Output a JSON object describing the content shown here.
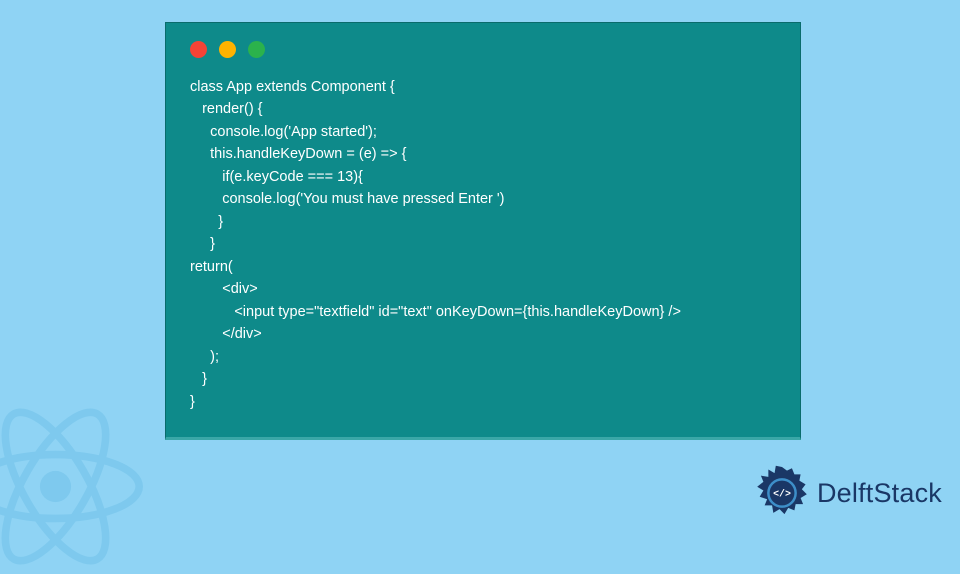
{
  "code_window": {
    "lines": [
      "class App extends Component {",
      "   render() {",
      "     console.log('App started');",
      "     this.handleKeyDown = (e) => {",
      "        if(e.keyCode === 13){",
      "        console.log('You must have pressed Enter ')",
      "       }",
      "     }",
      "return(",
      "        <div>",
      "           <input type=\"textfield\" id=\"text\" onKeyDown={this.handleKeyDown} />",
      "        </div>",
      "     );",
      "   }",
      "}"
    ]
  },
  "brand": {
    "name": "DelftStack"
  },
  "colors": {
    "page_bg": "#8fd3f4",
    "window_bg": "#0e8a8a",
    "code_text": "#ffffff",
    "brand_text": "#1a3766"
  }
}
